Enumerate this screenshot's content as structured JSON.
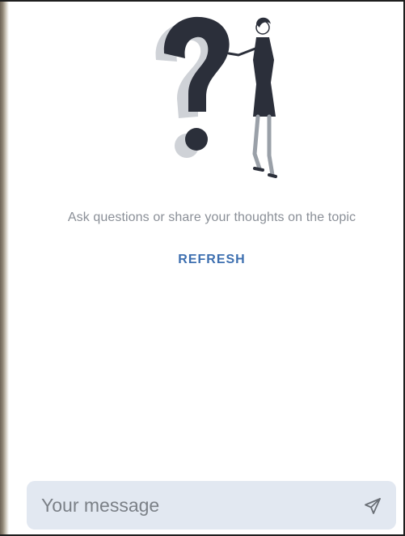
{
  "empty_state": {
    "illustration": "woman-pointing-at-question-mark",
    "prompt": "Ask questions or share your thoughts on the topic",
    "refresh_label": "REFRESH"
  },
  "composer": {
    "placeholder": "Your message",
    "value": "",
    "send_icon": "send-icon"
  },
  "colors": {
    "accent": "#3d6fb0",
    "muted_text": "#8a8f97",
    "composer_bg": "#e2e8f1",
    "illustration_dark": "#2b2f3a"
  }
}
